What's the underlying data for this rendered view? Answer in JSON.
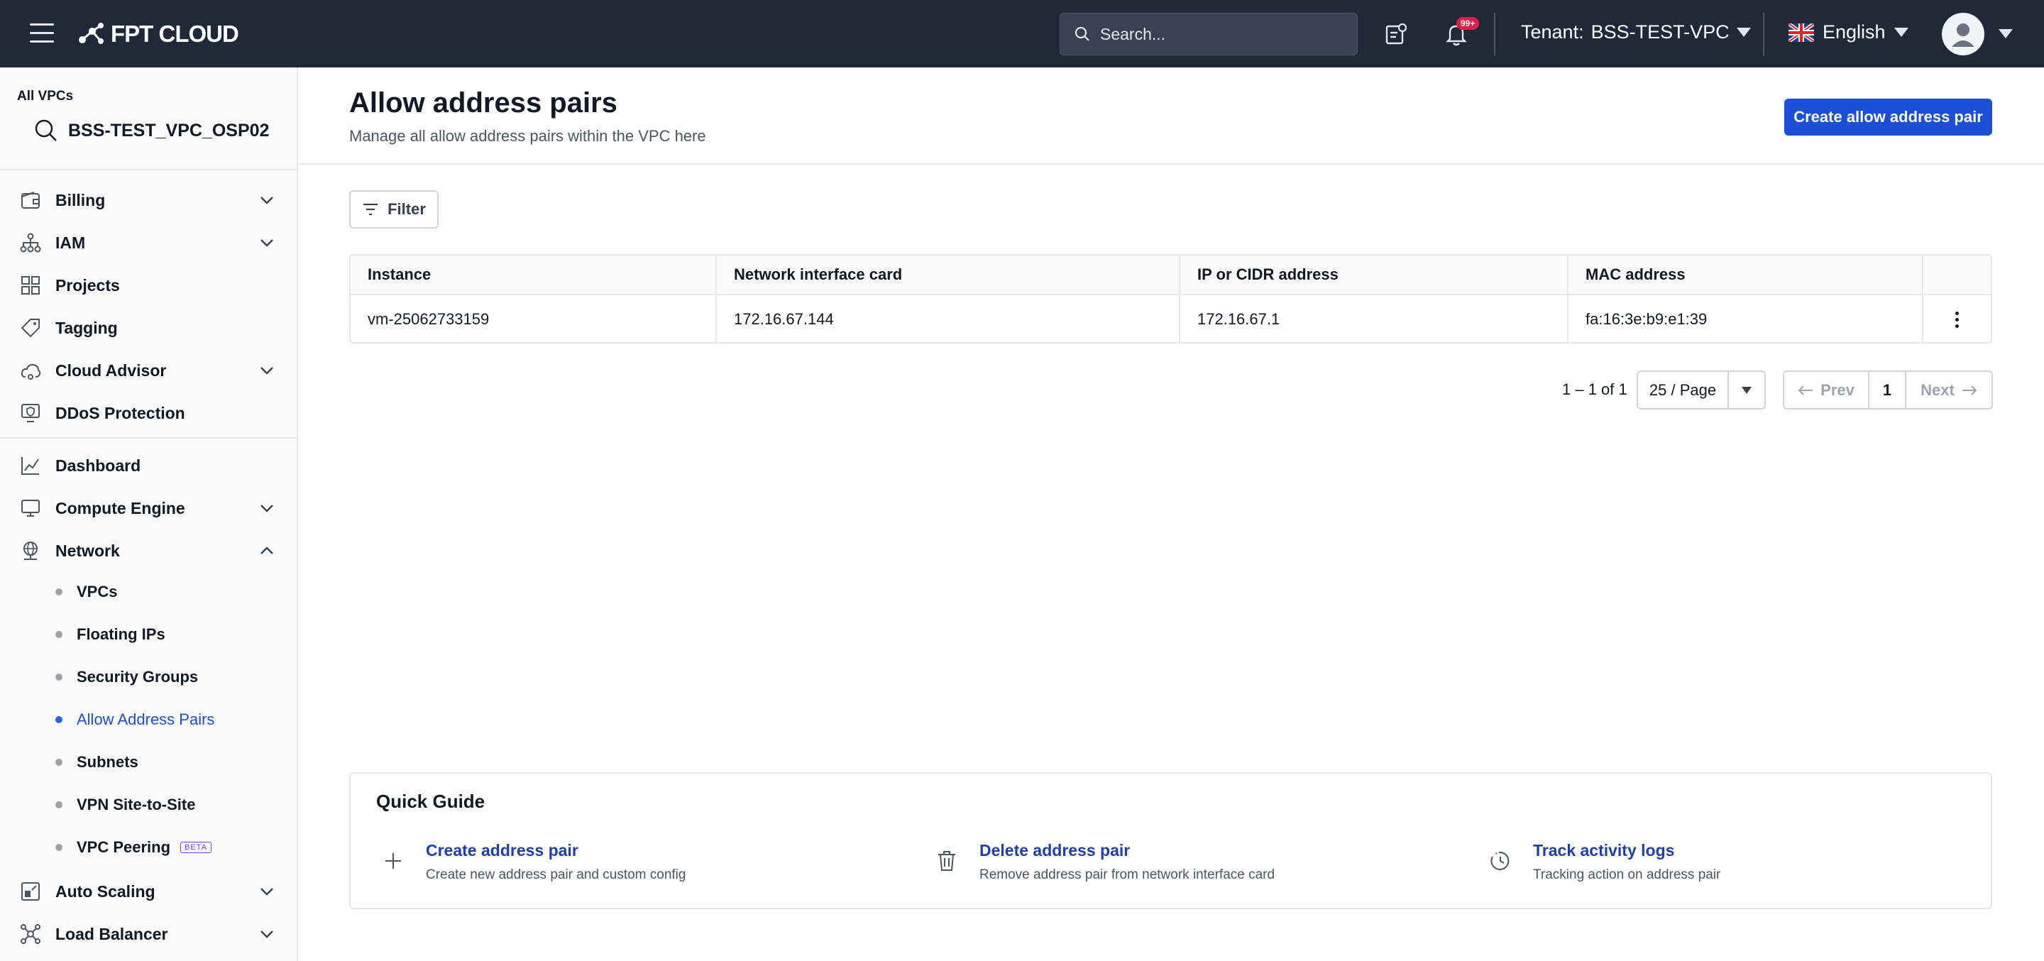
{
  "topbar": {
    "brand": "FPT CLOUD",
    "search_placeholder": "Search...",
    "notification_count": "99+",
    "tenant_label": "Tenant:",
    "tenant_value": "BSS-TEST-VPC",
    "language": "English"
  },
  "sidebar": {
    "vpc_label": "All VPCs",
    "vpc_name": "BSS-TEST_VPC_OSP02",
    "items": [
      {
        "label": "Billing"
      },
      {
        "label": "IAM"
      },
      {
        "label": "Projects"
      },
      {
        "label": "Tagging"
      },
      {
        "label": "Cloud Advisor"
      },
      {
        "label": "DDoS Protection"
      },
      {
        "label": "Dashboard"
      },
      {
        "label": "Compute Engine"
      },
      {
        "label": "Network"
      },
      {
        "label": "Auto Scaling"
      },
      {
        "label": "Load Balancer"
      }
    ],
    "network_sub": [
      {
        "label": "VPCs"
      },
      {
        "label": "Floating IPs"
      },
      {
        "label": "Security Groups"
      },
      {
        "label": "Allow Address Pairs"
      },
      {
        "label": "Subnets"
      },
      {
        "label": "VPN Site-to-Site"
      },
      {
        "label": "VPC Peering",
        "badge": "BETA"
      }
    ]
  },
  "main": {
    "title": "Allow address pairs",
    "subtitle": "Manage all allow address pairs within the VPC here",
    "create_button": "Create allow address pair",
    "filter_button": "Filter",
    "table": {
      "headers": [
        "Instance",
        "Network interface card",
        "IP or CIDR address",
        "MAC address"
      ],
      "rows": [
        [
          "vm-25062733159",
          "172.16.67.144",
          "172.16.67.1",
          "fa:16:3e:b9:e1:39"
        ]
      ]
    },
    "pagination": {
      "range": "1 – 1 of 1",
      "per_page": "25 / Page",
      "prev": "Prev",
      "current": "1",
      "next": "Next"
    },
    "quick_guide": {
      "title": "Quick Guide",
      "items": [
        {
          "title": "Create address pair",
          "desc": "Create new address pair and custom config"
        },
        {
          "title": "Delete address pair",
          "desc": "Remove address pair from network interface card"
        },
        {
          "title": "Track activity logs",
          "desc": "Tracking action on address pair"
        }
      ]
    }
  },
  "colors": {
    "topbar_bg": "#1f2937",
    "primary": "#1d4ed8",
    "active_nav": "#1d4ed8"
  }
}
